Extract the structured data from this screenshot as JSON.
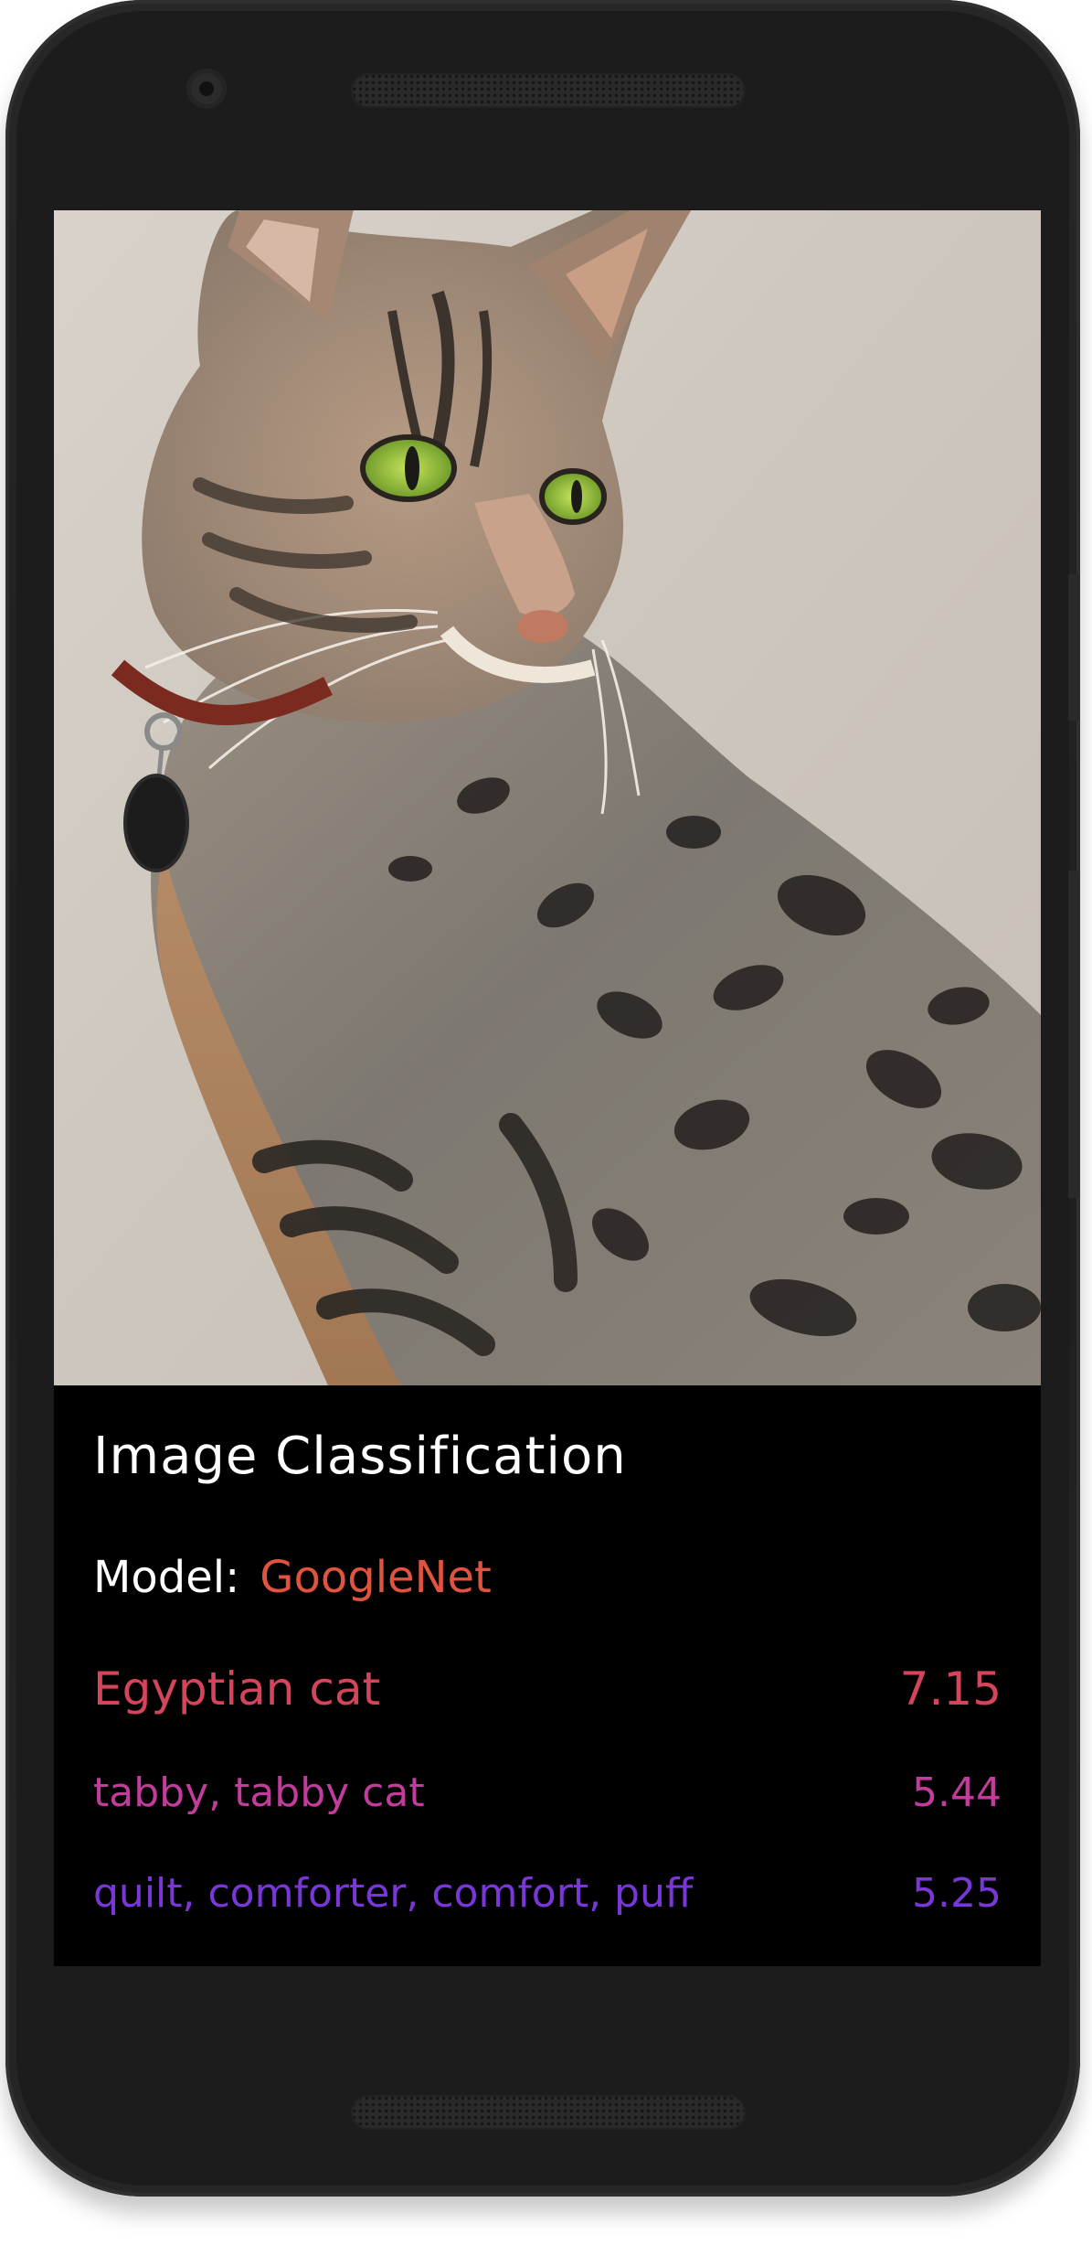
{
  "app": {
    "title": "Image Classification"
  },
  "model": {
    "label": "Model:",
    "name": "GoogleNet"
  },
  "results": [
    {
      "label": "Egyptian cat",
      "score": "7.15",
      "color": "#d4445a"
    },
    {
      "label": "tabby, tabby cat",
      "score": "5.44",
      "color": "#c23c9c"
    },
    {
      "label": "quilt, comforter, comfort, puff",
      "score": "5.25",
      "color": "#7a37d8"
    }
  ],
  "camera_preview": {
    "subject": "cat-photo"
  },
  "colors": {
    "background": "#000000",
    "model_name": "#e0543f",
    "title": "#ffffff"
  }
}
